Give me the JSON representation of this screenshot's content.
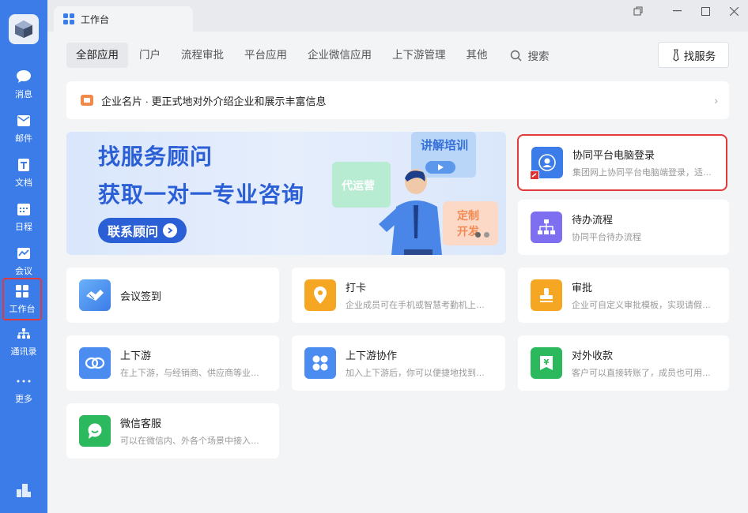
{
  "sidebar": {
    "items": [
      {
        "label": "消息",
        "icon": "chat-bubble-icon"
      },
      {
        "label": "邮件",
        "icon": "mail-icon"
      },
      {
        "label": "文档",
        "icon": "document-icon"
      },
      {
        "label": "日程",
        "icon": "calendar-icon"
      },
      {
        "label": "会议",
        "icon": "meeting-icon"
      },
      {
        "label": "工作台",
        "icon": "workbench-grid-icon"
      },
      {
        "label": "通讯录",
        "icon": "org-chart-icon"
      },
      {
        "label": "更多",
        "icon": "more-dots-icon"
      }
    ]
  },
  "titlebar": {
    "tab_label": "工作台"
  },
  "categories": [
    "全部应用",
    "门户",
    "流程审批",
    "平台应用",
    "企业微信应用",
    "上下游管理",
    "其他"
  ],
  "search_label": "搜索",
  "service_button": "找服务",
  "banner": {
    "text": "企业名片 · 更正式地对外介绍企业和展示丰富信息"
  },
  "promo": {
    "line1": "找服务顾问",
    "line2": "获取一对一专业咨询",
    "button": "联系顾问",
    "bubble_training": "讲解培训",
    "bubble_ops": "代运营",
    "bubble_custom": "定制开发"
  },
  "apps": [
    {
      "title": "协同平台电脑登录",
      "desc": "集团网上协同平台电脑端登录，适用于集团各单位",
      "icon": "person-badge-icon",
      "color": "#3b7ce8"
    },
    {
      "title": "待办流程",
      "desc": "协同平台待办流程",
      "icon": "flowchart-icon",
      "color": "#7d6ff0"
    },
    {
      "title": "会议签到",
      "desc": "",
      "icon": "handshake-icon",
      "color": "#4a8cf0"
    },
    {
      "title": "打卡",
      "desc": "企业成员可在手机或智慧考勤机上完成打卡",
      "icon": "location-pin-icon",
      "color": "#f5a623"
    },
    {
      "title": "审批",
      "desc": "企业可自定义审批模板，实现请假、报销等审批",
      "icon": "stamp-icon",
      "color": "#f5a623"
    },
    {
      "title": "上下游",
      "desc": "在上下游，与经销商、供应商等业务伙伴协同",
      "icon": "link-rings-icon",
      "color": "#4a8cf0"
    },
    {
      "title": "上下游协作",
      "desc": "加入上下游后，你可以便捷地找到相关联系人",
      "icon": "four-dots-icon",
      "color": "#4a8cf0"
    },
    {
      "title": "对外收款",
      "desc": "客户可以直接转账了，成员也可用收款码收款",
      "icon": "yuan-wallet-icon",
      "color": "#2cb85c"
    },
    {
      "title": "微信客服",
      "desc": "可以在微信内、外各个场景中接入微信客服",
      "icon": "chat-smile-icon",
      "color": "#2cb85c"
    }
  ]
}
